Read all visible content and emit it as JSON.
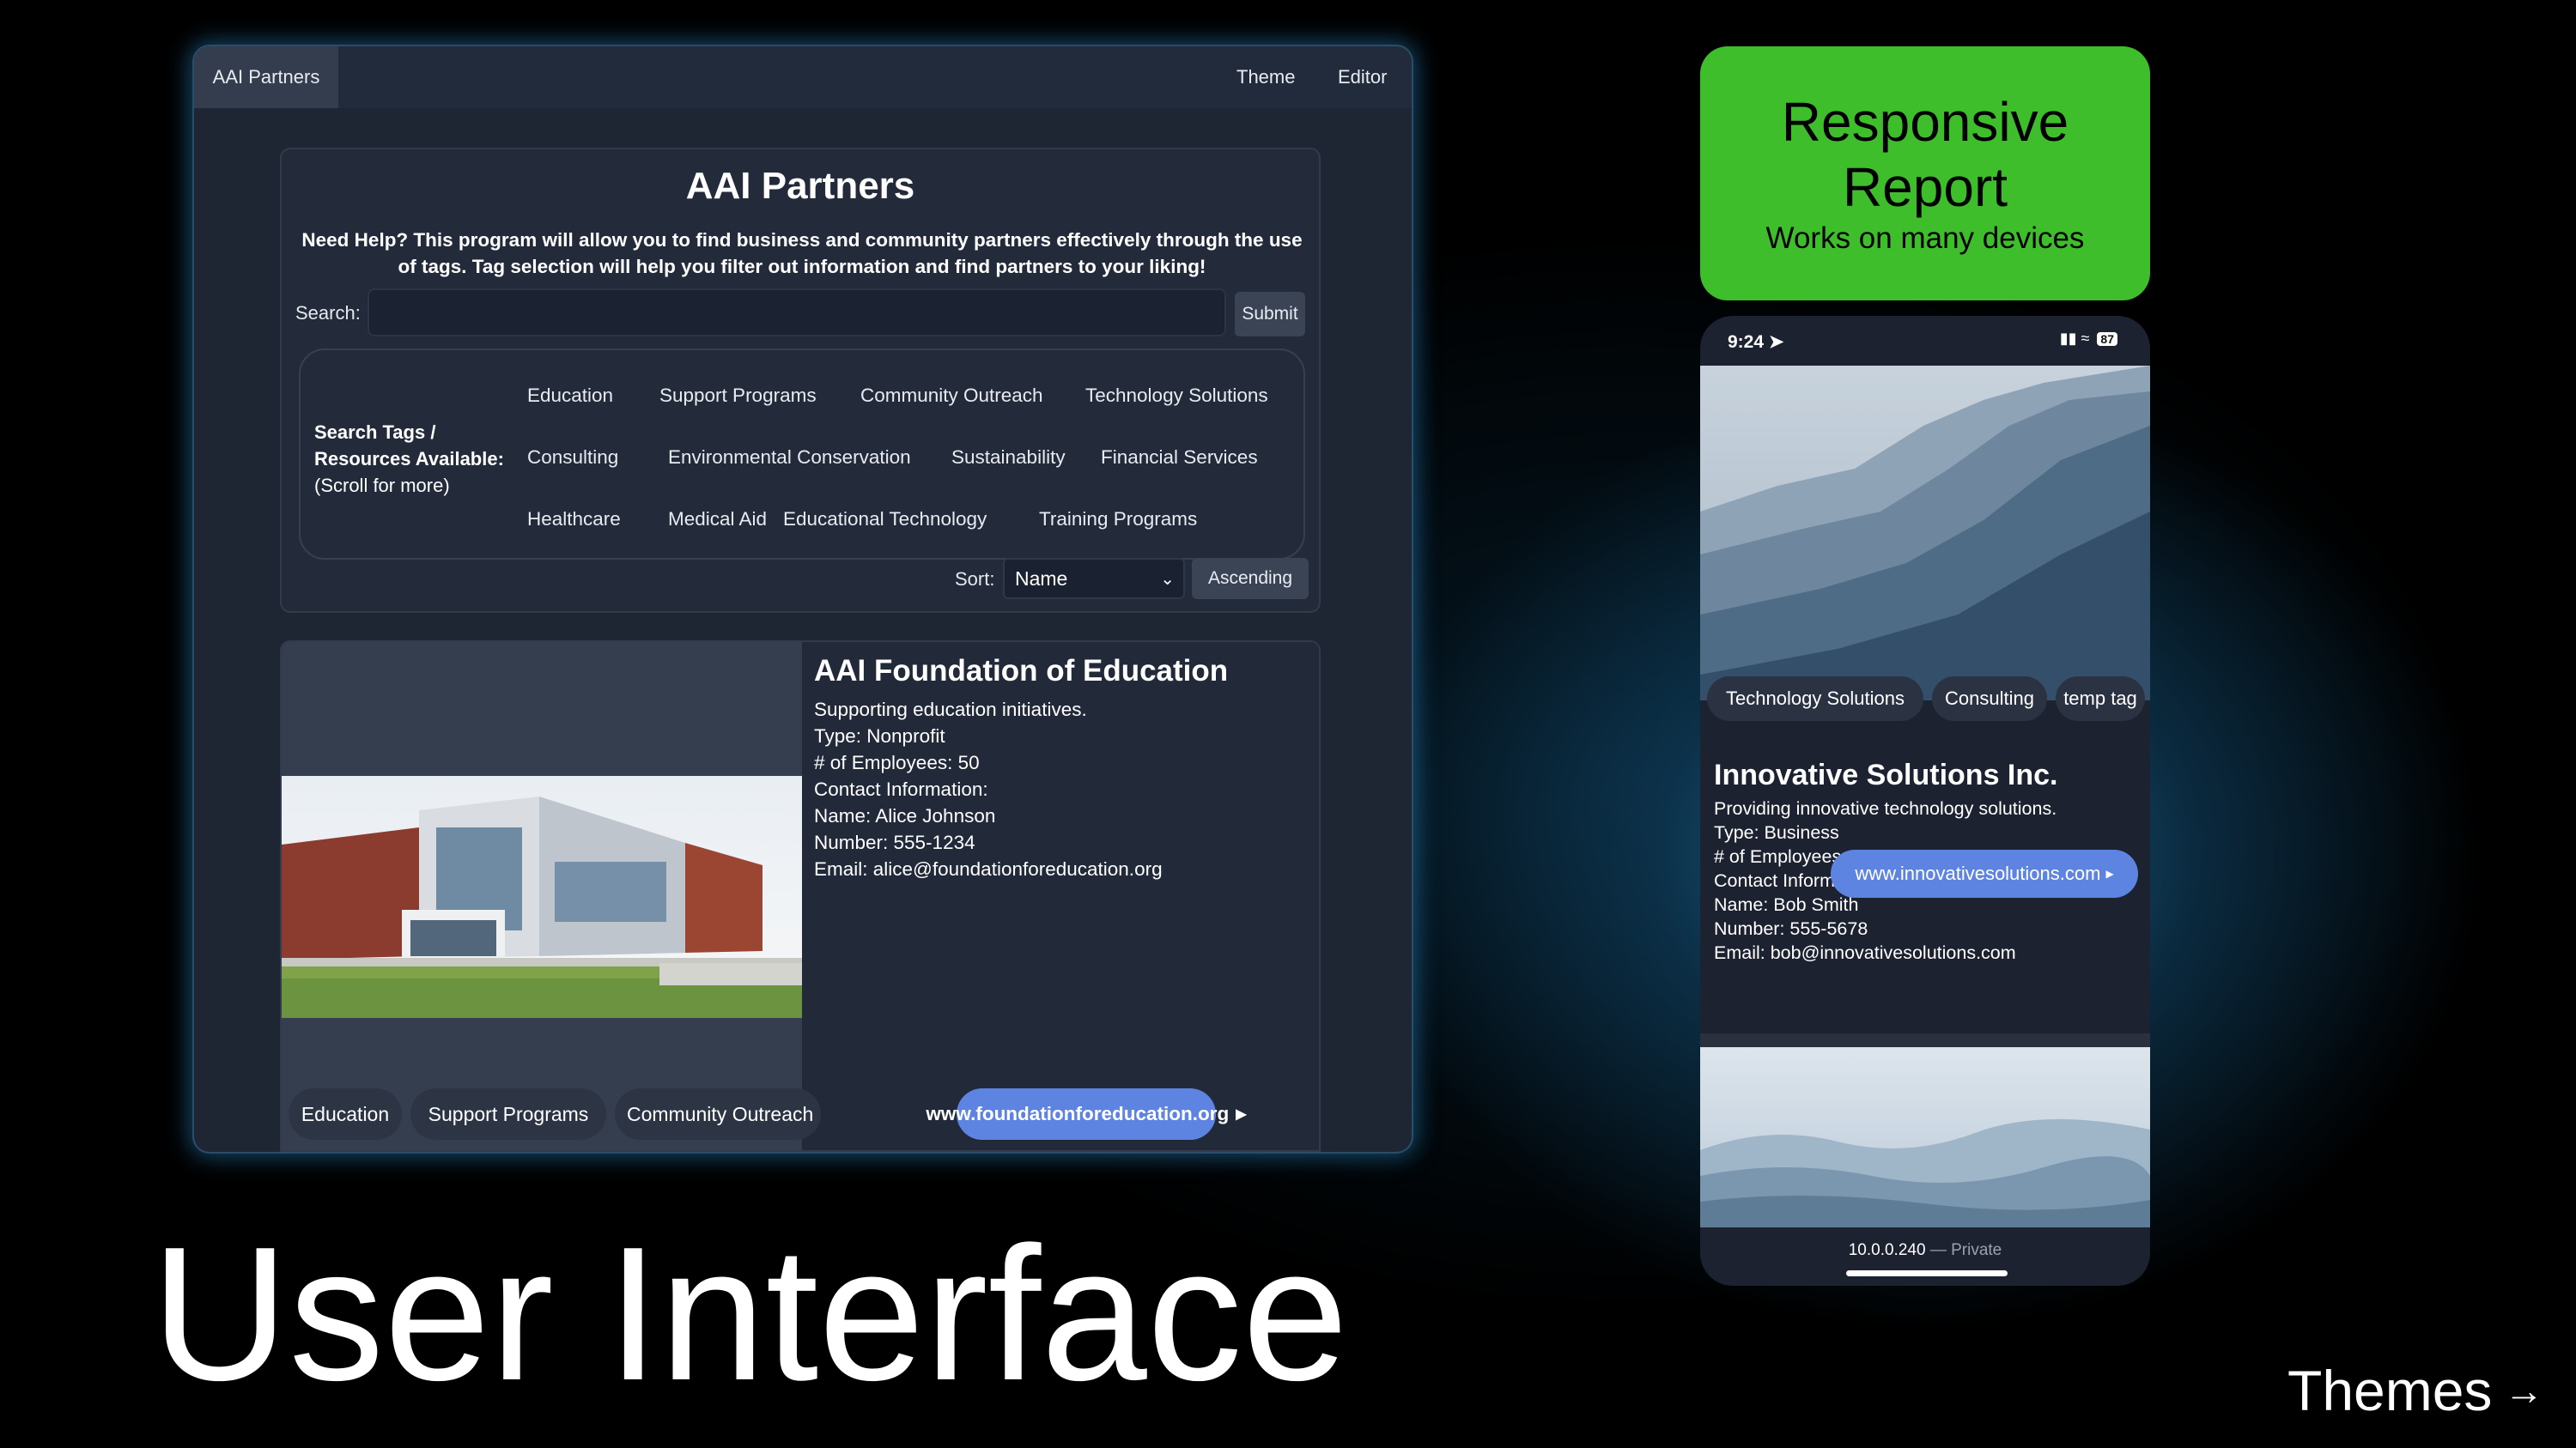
{
  "desktop": {
    "nav": {
      "brand": "AAI Partners",
      "theme": "Theme",
      "editor": "Editor"
    },
    "panel": {
      "title": "AAI Partners",
      "help_line1": "Need Help? This program will allow you to find business and community partners effectively through the use",
      "help_line2": "of tags. Tag selection will help you filter out information and find partners to your liking!",
      "search_label": "Search:",
      "search_value": "",
      "submit_label": "Submit",
      "tags_heading_1": "Search Tags /",
      "tags_heading_2": "Resources Available:",
      "tags_heading_3": "(Scroll for more)",
      "tags": [
        "Education",
        "Support Programs",
        "Community Outreach",
        "Technology Solutions",
        "Consulting",
        "Environmental Conservation",
        "Sustainability",
        "Financial Services",
        "Healthcare",
        "Medical Aid",
        "Educational Technology",
        "Training Programs"
      ],
      "sort_label": "Sort:",
      "sort_value": "Name",
      "order_label": "Ascending"
    },
    "card": {
      "name": "AAI Foundation of Education",
      "lines": [
        "Supporting education initiatives.",
        "Type: Nonprofit",
        "# of Employees: 50",
        "Contact Information:",
        "Name: Alice Johnson",
        "Number: 555-1234",
        "Email: alice@foundationforeducation.org"
      ],
      "tags": [
        "Education",
        "Support Programs",
        "Community Outreach"
      ],
      "website": "www.foundationforeducation.org"
    }
  },
  "badge": {
    "title_line1": "Responsive",
    "title_line2": "Report",
    "subtitle": "Works on many devices",
    "color": "#3fbe2b"
  },
  "phone": {
    "time": "9:24",
    "battery": "87",
    "tags": [
      "Technology Solutions",
      "Consulting",
      "temp tag"
    ],
    "card": {
      "name": "Innovative Solutions Inc.",
      "lines": [
        "Providing innovative technology solutions.",
        "Type: Business",
        "# of Employees: 200",
        "Contact Information:",
        "Name: Bob Smith",
        "Number: 555-5678",
        "Email: bob@innovativesolutions.com"
      ],
      "website": "www.innovativesolutions.com"
    },
    "url": "10.0.0.240",
    "url_suffix": "— Private"
  },
  "caption": "User Interface",
  "next_link": "Themes",
  "accent_color": "#5e84e2"
}
